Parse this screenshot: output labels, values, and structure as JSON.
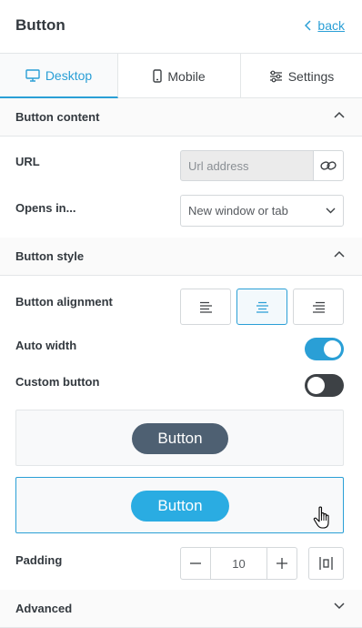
{
  "header": {
    "title": "Button",
    "back_label": "back"
  },
  "tabs": [
    {
      "label": "Desktop",
      "icon": "monitor-icon",
      "active": true
    },
    {
      "label": "Mobile",
      "icon": "mobile-icon",
      "active": false
    },
    {
      "label": "Settings",
      "icon": "sliders-icon",
      "active": false
    }
  ],
  "sections": {
    "content": {
      "title": "Button content",
      "expanded": true
    },
    "style": {
      "title": "Button style",
      "expanded": true
    },
    "advanced": {
      "title": "Advanced",
      "expanded": false
    }
  },
  "url": {
    "label": "URL",
    "placeholder": "Url address",
    "value": ""
  },
  "opens_in": {
    "label": "Opens in...",
    "selected": "New window or tab"
  },
  "alignment": {
    "label": "Button alignment",
    "options": [
      "left",
      "center",
      "right"
    ],
    "selected": "center"
  },
  "auto_width": {
    "label": "Auto width",
    "on": true
  },
  "custom_button": {
    "label": "Custom button",
    "on": false
  },
  "presets": [
    {
      "label": "Button",
      "color": "#4e6072",
      "selected": false
    },
    {
      "label": "Button",
      "color": "#2aace2",
      "selected": true
    }
  ],
  "padding": {
    "label": "Padding",
    "value": "10"
  },
  "colors": {
    "accent": "#2a9fd6",
    "dark": "#3d4145"
  }
}
